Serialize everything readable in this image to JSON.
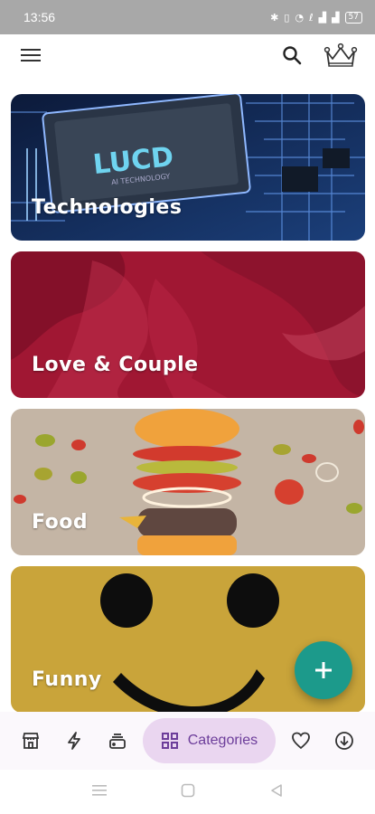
{
  "status_bar": {
    "time": "13:56",
    "icons": [
      "bluetooth-icon",
      "vibrate-icon",
      "wifi-icon",
      "volte-icon",
      "signal-icon",
      "signal-icon"
    ],
    "battery": "57"
  },
  "app_bar": {
    "menu_icon": "hamburger-menu-icon",
    "search_icon": "search-icon",
    "premium_icon": "crown-icon"
  },
  "categories": [
    {
      "label": "Technologies"
    },
    {
      "label": "Love & Couple"
    },
    {
      "label": "Food"
    },
    {
      "label": "Funny"
    }
  ],
  "tech_card_art_text": {
    "logo": "LUCD",
    "sub": "AI TECHNOLOGY"
  },
  "fab": {
    "icon": "plus-icon"
  },
  "bottom_nav": {
    "items": [
      "store-icon",
      "bolt-icon",
      "layers-icon",
      "grid-icon",
      "heart-icon",
      "download-icon"
    ],
    "active_label": "Categories"
  },
  "colors": {
    "accent": "#1c9a8b",
    "active_nav_bg": "#ead6f0",
    "active_nav_text": "#6c3d9a",
    "love_card": "#9a1530",
    "food_card": "#c2b3a4",
    "funny_card": "#c9a43a"
  }
}
